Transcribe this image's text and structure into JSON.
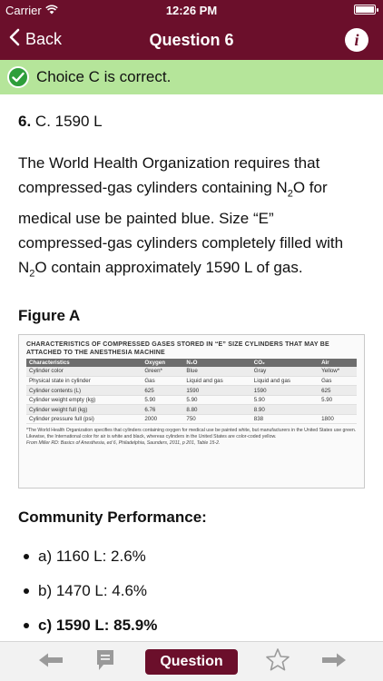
{
  "status": {
    "carrier": "Carrier",
    "time": "12:26 PM"
  },
  "nav": {
    "back_label": "Back",
    "title": "Question 6"
  },
  "banner": {
    "text": "Choice C is correct."
  },
  "answer": {
    "number": "6.",
    "text": "C. 1590 L"
  },
  "explanation": {
    "part1": "The World Health Organization requires that compressed-gas cylinders containing N",
    "sub1": "2",
    "part2": "O for medical use be painted blue. Size “E” compressed-gas cylinders completely filled with N",
    "sub2": "2",
    "part3": "O contain approximately 1590 L of gas."
  },
  "figure": {
    "heading": "Figure A",
    "title": "CHARACTERISTICS OF COMPRESSED GASES STORED IN “E” SIZE CYLINDERS THAT MAY BE ATTACHED TO THE ANESTHESIA MACHINE",
    "columns": [
      "Characteristics",
      "Oxygen",
      "N₂O",
      "CO₂",
      "Air"
    ],
    "rows": [
      [
        "Cylinder color",
        "Green*",
        "Blue",
        "Gray",
        "Yellow*"
      ],
      [
        "Physical state in cylinder",
        "Gas",
        "Liquid and gas",
        "Liquid and gas",
        "Gas"
      ],
      [
        "Cylinder contents (L)",
        "625",
        "1590",
        "1590",
        "625"
      ],
      [
        "Cylinder weight empty (kg)",
        "5.90",
        "5.90",
        "5.90",
        "5.90"
      ],
      [
        "Cylinder weight full (kg)",
        "6.76",
        "8.80",
        "8.90",
        ""
      ],
      [
        "Cylinder pressure full (psi)",
        "2000",
        "750",
        "838",
        "1800"
      ]
    ],
    "note": "*The World Health Organization specifies that cylinders containing oxygen for medical use be painted white, but manufacturers in the United States use green. Likewise, the International color for air is white and black, whereas cylinders in the United States are color-coded yellow.",
    "source": "From Miller RD: Basics of Anesthesia, ed 6, Philadelphia, Saunders, 2011, p 201, Table 15-2."
  },
  "community": {
    "heading": "Community Performance:",
    "items": [
      {
        "label": "a) 1160 L: 2.6%"
      },
      {
        "label": "b) 1470 L: 4.6%"
      },
      {
        "label": "c) 1590 L: 85.9%"
      }
    ]
  },
  "toolbar": {
    "question_label": "Question"
  },
  "colors": {
    "brand": "#6b0f2b",
    "banner_bg": "#b5e59a",
    "check": "#2e9e3a"
  },
  "icons": [
    "wifi-icon",
    "battery-icon",
    "chevron-left-icon",
    "info-icon",
    "check-circle-icon",
    "arrow-left-icon",
    "notes-icon",
    "star-icon",
    "arrow-right-icon"
  ]
}
